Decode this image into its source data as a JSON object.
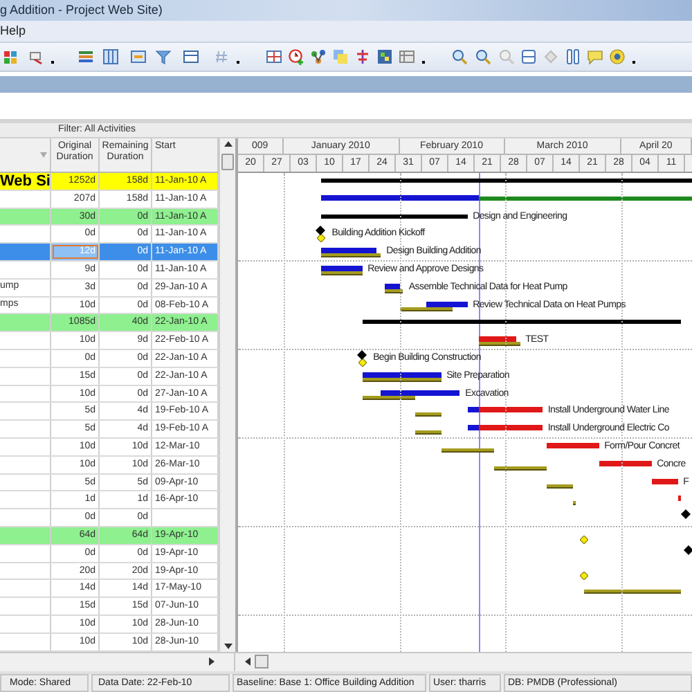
{
  "window": {
    "title": "g Addition - Project Web Site)"
  },
  "menu": [
    "Help"
  ],
  "filter": "Filter: All Activities",
  "columns": [
    {
      "label": "Original Duration"
    },
    {
      "label": "Remaining Duration"
    },
    {
      "label": "Start"
    }
  ],
  "timescale": {
    "months": [
      "009",
      "January 2010",
      "February 2010",
      "March 2010",
      "April 20"
    ],
    "weeks": [
      "20",
      "27",
      "03",
      "10",
      "17",
      "24",
      "31",
      "07",
      "14",
      "21",
      "28",
      "07",
      "14",
      "21",
      "28",
      "04",
      "11"
    ]
  },
  "rows": [
    {
      "name": "Web Si",
      "original": "1252d",
      "remaining": "158d",
      "start": "11-Jan-10 A",
      "kind": "project",
      "selected": false,
      "focused": false
    },
    {
      "original": "207d",
      "remaining": "158d",
      "start": "11-Jan-10 A",
      "kind": "activity",
      "selected": false,
      "focused": false
    },
    {
      "original": "30d",
      "remaining": "0d",
      "start": "11-Jan-10 A",
      "kind": "wbs",
      "selected": false,
      "focused": false,
      "label": "Design and Engineering"
    },
    {
      "original": "0d",
      "remaining": "0d",
      "start": "11-Jan-10 A",
      "kind": "activity",
      "selected": false,
      "focused": false,
      "label": "Building Addition Kickoff"
    },
    {
      "original": "12d",
      "remaining": "0d",
      "start": "11-Jan-10 A",
      "kind": "activity",
      "selected": true,
      "focused": true,
      "label": "Design Building Addition"
    },
    {
      "original": "9d",
      "remaining": "0d",
      "start": "11-Jan-10 A",
      "kind": "activity",
      "selected": false,
      "focused": false,
      "label": "Review and Approve Designs"
    },
    {
      "name": "ump",
      "original": "3d",
      "remaining": "0d",
      "start": "29-Jan-10 A",
      "kind": "activity",
      "selected": false,
      "focused": false,
      "label": "Assemble Technical Data for Heat Pump"
    },
    {
      "name": "mps",
      "original": "10d",
      "remaining": "0d",
      "start": "08-Feb-10 A",
      "kind": "activity",
      "selected": false,
      "focused": false,
      "label": "Review Technical Data on Heat Pumps"
    },
    {
      "original": "1085d",
      "remaining": "40d",
      "start": "22-Jan-10 A",
      "kind": "wbs",
      "selected": false,
      "focused": false
    },
    {
      "original": "10d",
      "remaining": "9d",
      "start": "22-Feb-10 A",
      "kind": "activity",
      "selected": false,
      "focused": false,
      "label": "TEST"
    },
    {
      "original": "0d",
      "remaining": "0d",
      "start": "22-Jan-10 A",
      "kind": "activity",
      "selected": false,
      "focused": false,
      "label": "Begin Building Construction"
    },
    {
      "original": "15d",
      "remaining": "0d",
      "start": "22-Jan-10 A",
      "kind": "activity",
      "selected": false,
      "focused": false,
      "label": "Site Preparation"
    },
    {
      "original": "10d",
      "remaining": "0d",
      "start": "27-Jan-10 A",
      "kind": "activity",
      "selected": false,
      "focused": false,
      "label": "Excavation"
    },
    {
      "original": "5d",
      "remaining": "4d",
      "start": "19-Feb-10 A",
      "kind": "activity",
      "selected": false,
      "focused": false,
      "label": "Install Underground Water Line"
    },
    {
      "original": "5d",
      "remaining": "4d",
      "start": "19-Feb-10 A",
      "kind": "activity",
      "selected": false,
      "focused": false,
      "label": "Install Underground Electric Co"
    },
    {
      "original": "10d",
      "remaining": "10d",
      "start": "12-Mar-10",
      "kind": "activity",
      "selected": false,
      "focused": false,
      "label": "Form/Pour Concret"
    },
    {
      "original": "10d",
      "remaining": "10d",
      "start": "26-Mar-10",
      "kind": "activity",
      "selected": false,
      "focused": false,
      "label": "Concre"
    },
    {
      "original": "5d",
      "remaining": "5d",
      "start": "09-Apr-10",
      "kind": "activity",
      "selected": false,
      "focused": false,
      "label": "F"
    },
    {
      "original": "1d",
      "remaining": "1d",
      "start": "16-Apr-10",
      "kind": "activity",
      "selected": false,
      "focused": false
    },
    {
      "original": "0d",
      "remaining": "0d",
      "kind": "activity",
      "selected": false,
      "focused": false
    },
    {
      "original": "64d",
      "remaining": "64d",
      "start": "19-Apr-10",
      "kind": "wbs",
      "selected": false,
      "focused": false
    },
    {
      "original": "0d",
      "remaining": "0d",
      "start": "19-Apr-10",
      "kind": "activity",
      "selected": false,
      "focused": false
    },
    {
      "original": "20d",
      "remaining": "20d",
      "start": "19-Apr-10",
      "kind": "activity",
      "selected": false,
      "focused": false
    },
    {
      "original": "14d",
      "remaining": "14d",
      "start": "17-May-10",
      "kind": "activity",
      "selected": false,
      "focused": false
    },
    {
      "original": "15d",
      "remaining": "15d",
      "start": "07-Jun-10",
      "kind": "activity",
      "selected": false,
      "focused": false
    },
    {
      "original": "10d",
      "remaining": "10d",
      "start": "28-Jun-10",
      "kind": "activity",
      "selected": false,
      "focused": false
    },
    {
      "original": "10d",
      "remaining": "10d",
      "start": "28-Jun-10",
      "kind": "activity",
      "selected": false,
      "focused": false
    }
  ],
  "status_bar": [
    "Mode: Shared",
    "Data Date: 22-Feb-10",
    "Baseline: Base 1: Office Building Addition",
    "User: tharris",
    "DB: PMDB (Professional)"
  ]
}
